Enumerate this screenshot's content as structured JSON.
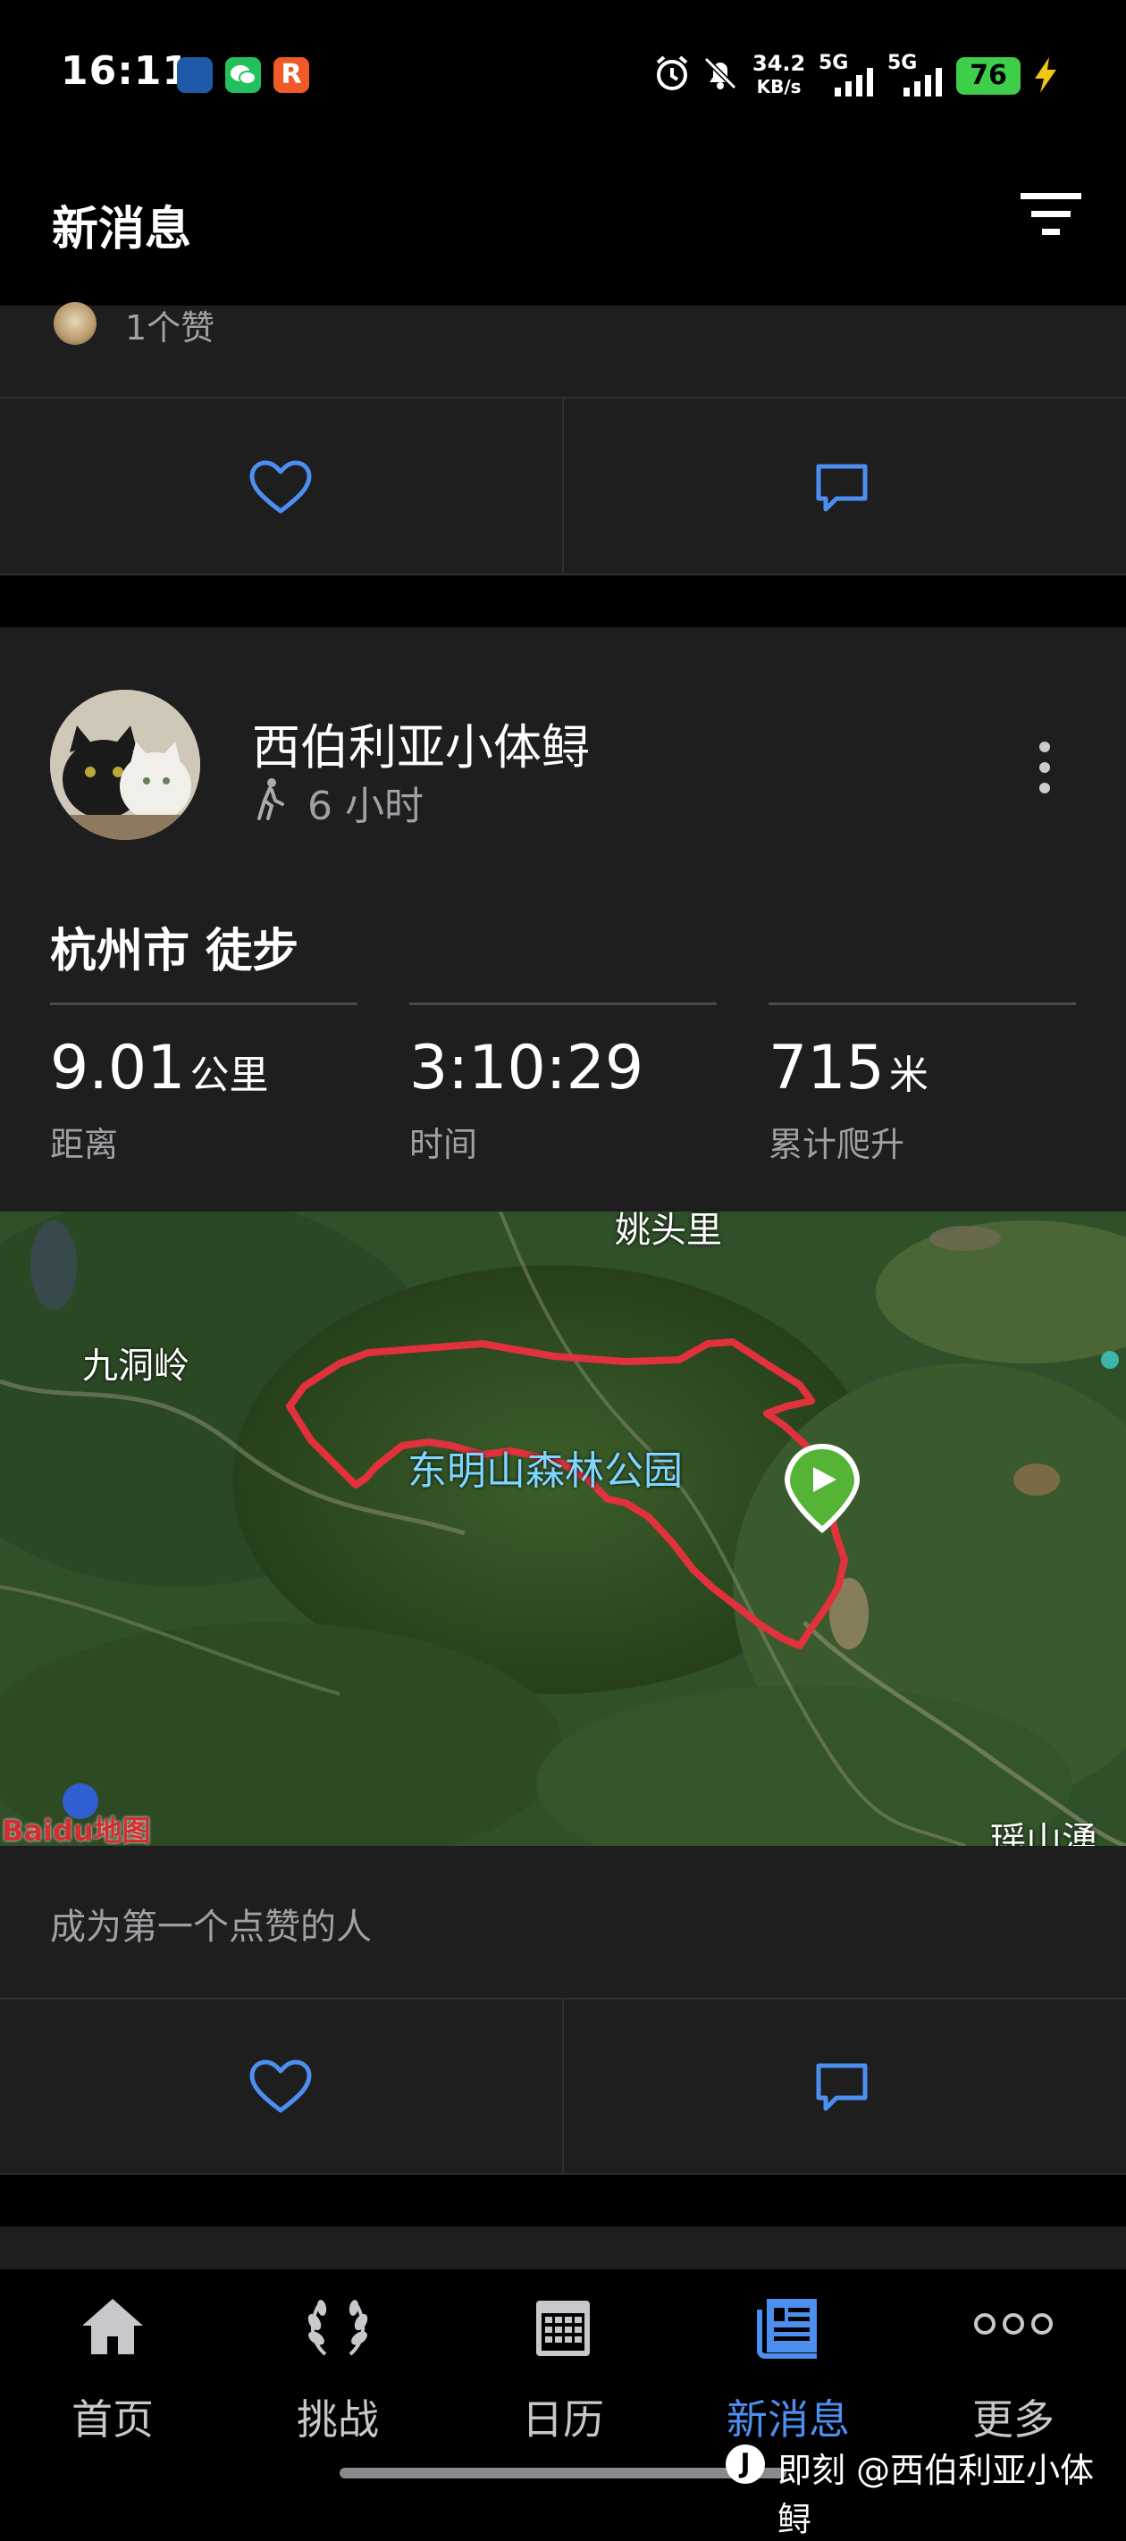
{
  "status_bar": {
    "time": "16:11",
    "net_speed_value": "34.2",
    "net_speed_unit": "KB/s",
    "sim1": "5G",
    "sim2": "5G",
    "battery": "76"
  },
  "header": {
    "title": "新消息"
  },
  "prev_card": {
    "likes_text": "1个赞"
  },
  "post": {
    "author": "西伯利亚小体鲟",
    "time_ago": "6 小时",
    "activity_title": "杭州市 徒步",
    "stats": [
      {
        "value": "9.01",
        "unit": "公里",
        "label": "距离"
      },
      {
        "value": "3:10:29",
        "unit": "",
        "label": "时间"
      },
      {
        "value": "715",
        "unit": "米",
        "label": "累计爬升"
      }
    ],
    "map": {
      "labels": {
        "north": "姚头里",
        "west": "九洞岭",
        "park": "东明山森林公园",
        "southeast": "瑶山湧"
      },
      "provider": "Baidu地图"
    },
    "like_prompt": "成为第一个点赞的人"
  },
  "bottom_nav": {
    "items": [
      {
        "label": "首页",
        "icon": "home-icon"
      },
      {
        "label": "挑战",
        "icon": "laurel-icon"
      },
      {
        "label": "日历",
        "icon": "calendar-icon"
      },
      {
        "label": "新消息",
        "icon": "newsfeed-icon"
      },
      {
        "label": "更多",
        "icon": "more-dots-icon"
      }
    ],
    "active_index": 3
  },
  "watermark": "即刻 @西伯利亚小体鲟",
  "colors": {
    "accent": "#4d8ff0",
    "route": "#e0313d",
    "card_bg": "#1e1e1f",
    "battery": "#3ecf4a"
  }
}
